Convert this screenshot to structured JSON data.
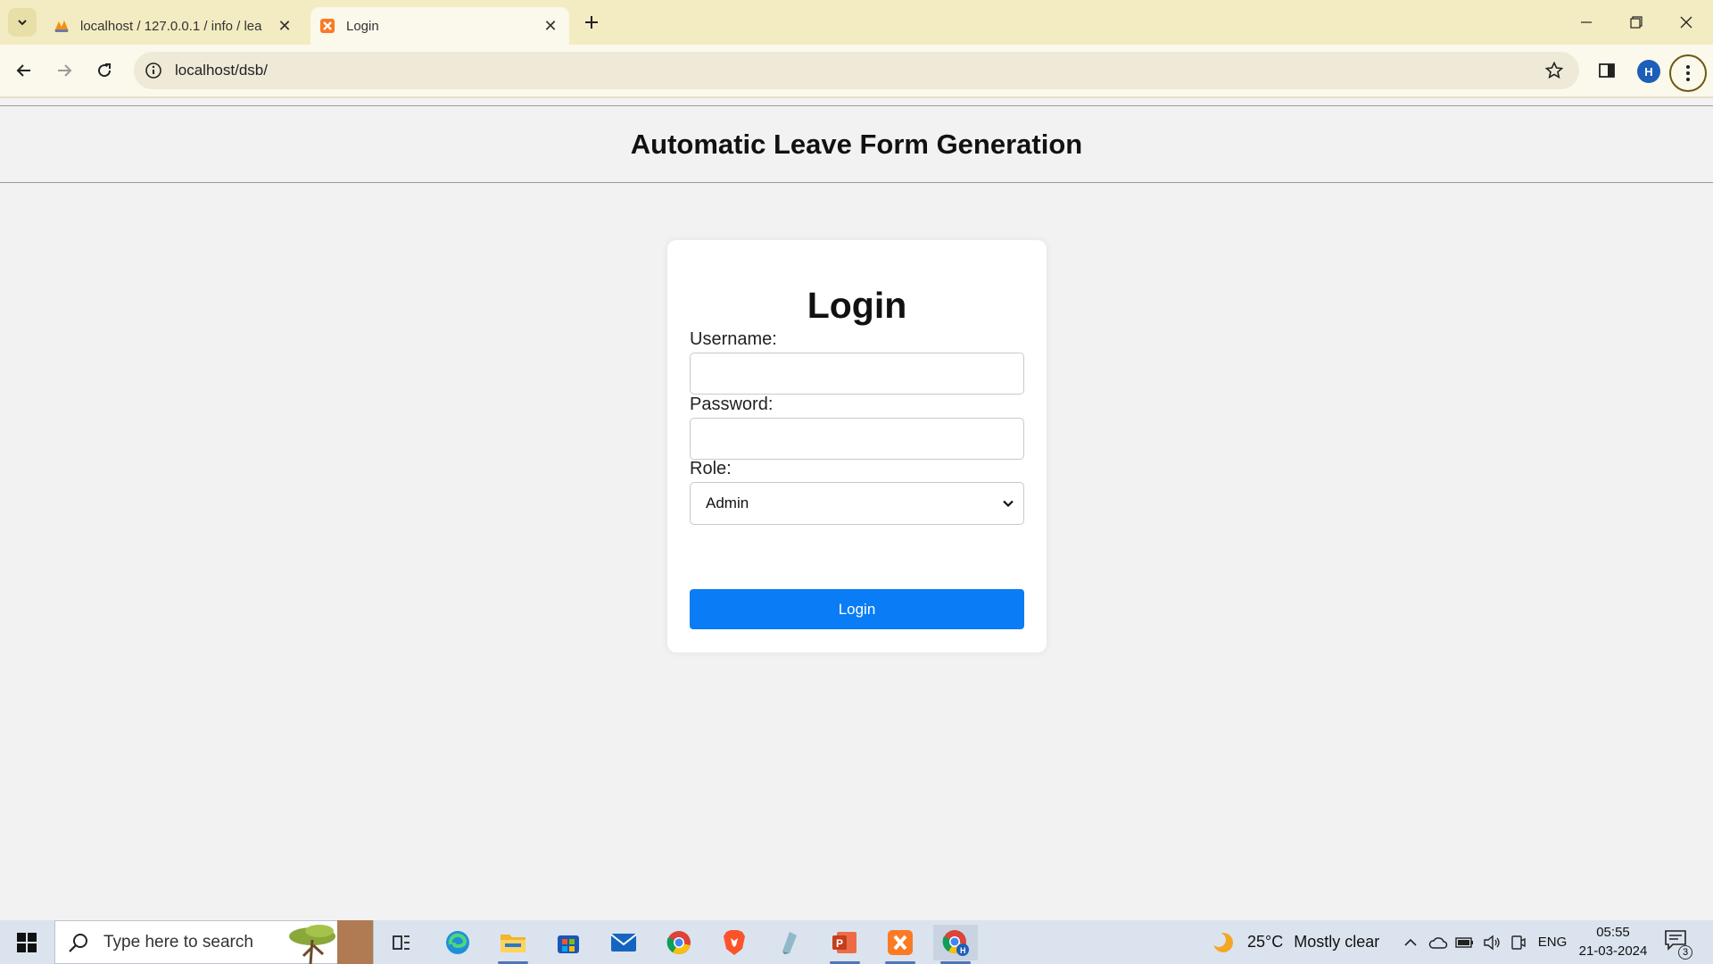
{
  "browser": {
    "tabs": [
      {
        "title": "localhost / 127.0.0.1 / info / lea",
        "icon": "phpmyadmin-icon",
        "active": false
      },
      {
        "title": "Login",
        "icon": "xampp-icon",
        "active": true
      }
    ],
    "url": "localhost/dsb/",
    "profile_initial": "H",
    "accent_color": "#f3ecc2"
  },
  "page": {
    "header_title": "Automatic Leave Form Generation",
    "login": {
      "heading": "Login",
      "username_label": "Username:",
      "username_value": "",
      "password_label": "Password:",
      "password_value": "",
      "role_label": "Role:",
      "role_selected": "Admin",
      "submit_label": "Login",
      "button_color": "#0a7cf6"
    }
  },
  "taskbar": {
    "search_placeholder": "Type here to search",
    "apps": [
      "task-view-icon",
      "edge-icon",
      "file-explorer-icon",
      "store-icon",
      "mail-icon",
      "chrome-icon",
      "brave-icon",
      "app-icon",
      "powerpoint-icon",
      "xampp-icon",
      "chrome-profile-icon"
    ],
    "weather_temp": "25°C",
    "weather_desc": "Mostly clear",
    "language": "ENG",
    "time": "05:55",
    "date": "21-03-2024",
    "notification_count": "3"
  }
}
